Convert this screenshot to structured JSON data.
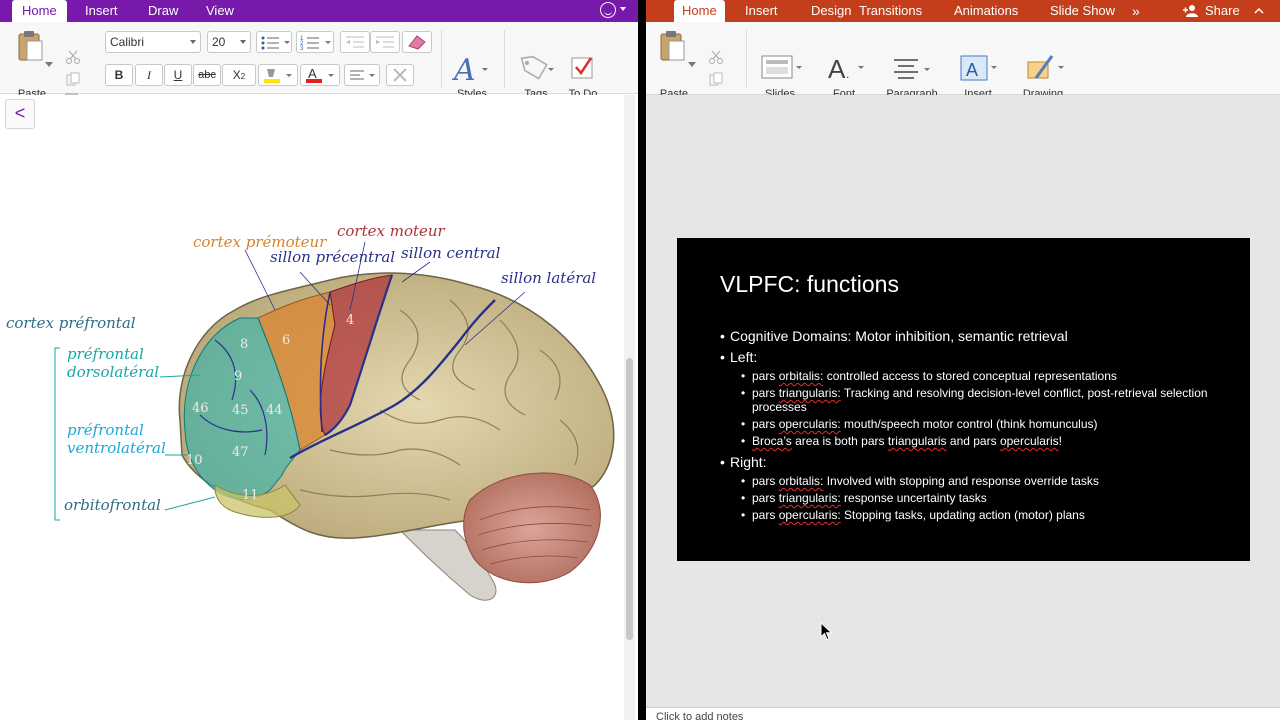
{
  "onenote": {
    "tabs": [
      "Home",
      "Insert",
      "Draw",
      "View"
    ],
    "active_tab": "Home",
    "ribbon": {
      "paste_label": "Paste",
      "font_name": "Calibri",
      "font_size": "20",
      "bold": "B",
      "italic": "I",
      "underline": "U",
      "strike": "abc",
      "subscript": "X",
      "styles_label": "Styles",
      "tags_label": "Tags",
      "todo_label": "To Do"
    },
    "back_glyph": "<",
    "brain_labels": {
      "cortex_premoteur": "cortex prémoteur",
      "cortex_moteur": "cortex moteur",
      "sillon_precentral": "sillon précentral",
      "sillon_central": "sillon central",
      "sillon_lateral": "sillon latéral",
      "cortex_prefrontal": "cortex préfrontal",
      "prefrontal_dorso_1": "préfrontal",
      "prefrontal_dorso_2": "dorsolatéral",
      "prefrontal_ventro_1": "préfrontal",
      "prefrontal_ventro_2": "ventrolatéral",
      "orbitofrontal": "orbitofrontal"
    },
    "brodmann_areas": [
      "4",
      "6",
      "8",
      "9",
      "46",
      "45",
      "44",
      "47",
      "10",
      "11"
    ],
    "colors": {
      "accent": "#7719aa",
      "premoteur": "#d9822b",
      "moteur": "#b0303a",
      "sulcus": "#2a2f8a",
      "prefrontal": "#1fb5b5",
      "prefrontal_label": "#17a7a7"
    }
  },
  "ppt": {
    "tabs": [
      "Home",
      "Insert",
      "Design",
      "Transitions",
      "Animations",
      "Slide Show"
    ],
    "active_tab": "Home",
    "more_glyph": "»",
    "share_label": "Share",
    "ribbon": {
      "paste_label": "Paste",
      "slides_label": "Slides",
      "font_label": "Font",
      "paragraph_label": "Paragraph",
      "insert_label": "Insert",
      "drawing_label": "Drawing"
    },
    "notes_placeholder": "Click to add notes",
    "colors": {
      "accent": "#c43e1c"
    },
    "slide": {
      "title": "VLPFC: functions",
      "bullet_cognitive": "Cognitive Domains: Motor inhibition, semantic retrieval",
      "bullet_left": "Left:",
      "left": [
        {
          "lead": "pars ",
          "term": "orbitalis:",
          "rest": " controlled access to stored conceptual representations"
        },
        {
          "lead": "pars ",
          "term": "triangularis:",
          "rest": " Tracking and resolving decision-level conflict, post-retrieval selection processes"
        },
        {
          "lead": "pars ",
          "term": "opercularis:",
          "rest": " mouth/speech motor control (think homunculus)"
        }
      ],
      "broca": {
        "a": "Broca’s",
        "b": " area is both pars ",
        "c": "triangularis",
        "d": " and pars ",
        "e": "opercularis",
        "f": "!"
      },
      "bullet_right": "Right:",
      "right": [
        {
          "lead": "pars ",
          "term": "orbitalis:",
          "rest": " Involved with stopping and response override tasks"
        },
        {
          "lead": "pars ",
          "term": "triangularis:",
          "rest": " response uncertainty tasks"
        },
        {
          "lead": "pars ",
          "term": "opercularis:",
          "rest": " Stopping tasks, updating action (motor) plans"
        }
      ]
    }
  }
}
